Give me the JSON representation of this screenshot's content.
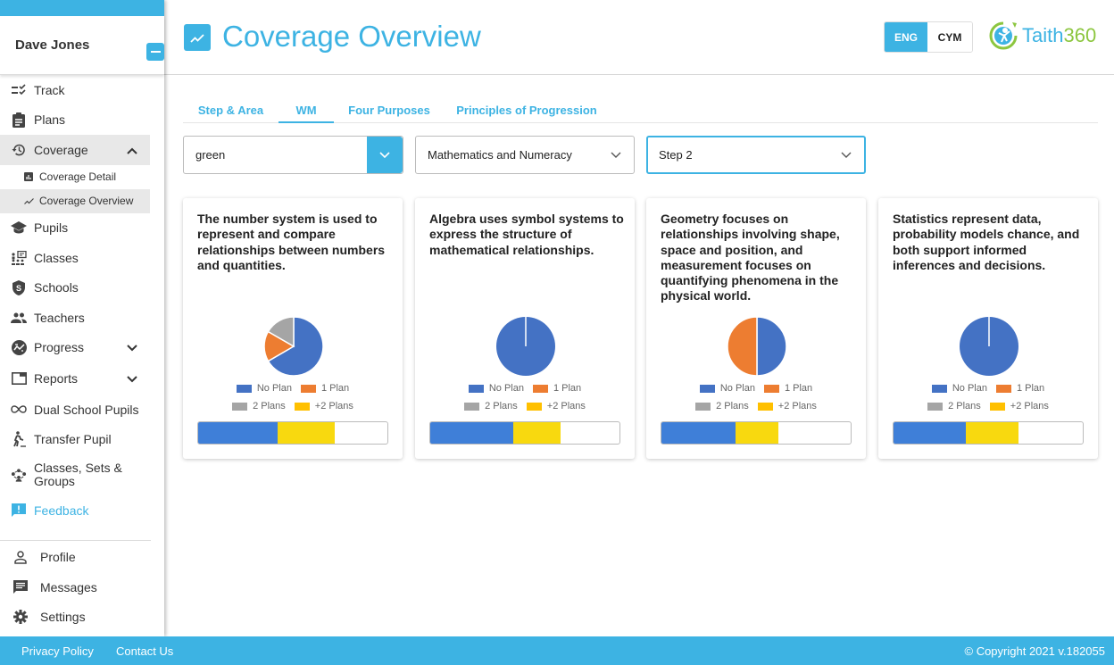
{
  "user": {
    "name": "Dave Jones"
  },
  "sidebar": {
    "items": [
      {
        "label": "Track",
        "icon": "track-icon"
      },
      {
        "label": "Plans",
        "icon": "clipboard-icon"
      },
      {
        "label": "Coverage",
        "icon": "history-icon",
        "expanded": true
      },
      {
        "label": "Coverage Detail",
        "icon": "bar-chart-icon"
      },
      {
        "label": "Coverage Overview",
        "icon": "trend-icon",
        "active": true
      },
      {
        "label": "Pupils",
        "icon": "graduation-cap-icon"
      },
      {
        "label": "Classes",
        "icon": "classroom-icon"
      },
      {
        "label": "Schools",
        "icon": "shield-icon"
      },
      {
        "label": "Teachers",
        "icon": "people-icon"
      },
      {
        "label": "Progress",
        "icon": "progress-icon"
      },
      {
        "label": "Reports",
        "icon": "window-icon"
      },
      {
        "label": "Dual School Pupils",
        "icon": "infinity-icon"
      },
      {
        "label": "Transfer Pupil",
        "icon": "walking-icon"
      },
      {
        "label": "Classes, Sets & Groups",
        "icon": "groups-icon"
      },
      {
        "label": "Feedback",
        "icon": "feedback-icon"
      }
    ],
    "bottom": [
      {
        "label": "Profile",
        "icon": "person-icon"
      },
      {
        "label": "Messages",
        "icon": "message-icon"
      },
      {
        "label": "Settings",
        "icon": "gear-icon"
      }
    ]
  },
  "header": {
    "title": "Coverage Overview",
    "lang_eng": "ENG",
    "lang_cym": "CYM",
    "logo_part1": "Taith",
    "logo_part2": "360"
  },
  "tabs": [
    {
      "label": "Step & Area",
      "active": false
    },
    {
      "label": "WM",
      "active": true
    },
    {
      "label": "Four Purposes",
      "active": false
    },
    {
      "label": "Principles of Progression",
      "active": false
    }
  ],
  "filters": {
    "group": "green",
    "area": "Mathematics and Numeracy",
    "step": "Step 2"
  },
  "legend": {
    "no_plan": "No Plan",
    "one_plan": "1 Plan",
    "two_plans": "2 Plans",
    "more_plans": "+2 Plans"
  },
  "colors": {
    "accent": "#3db3e3",
    "no_plan": "#4472c4",
    "one_plan": "#ed7d31",
    "two_plans": "#a5a5a5",
    "more_plans": "#ffc000",
    "bar_blue": "#3f7fd8",
    "bar_yellow": "#f8d90f"
  },
  "chart_data": [
    {
      "type": "pie",
      "title": "The number system is used to represent and compare relationships between numbers and quantities.",
      "categories": [
        "No Plan",
        "1 Plan",
        "2 Plans",
        "+2 Plans"
      ],
      "values": [
        66.7,
        16.7,
        16.7,
        0
      ],
      "progress": {
        "blue_pct": 42,
        "yellow_pct": 30
      }
    },
    {
      "type": "pie",
      "title": "Algebra uses symbol systems to express the structure of mathematical relationships.",
      "categories": [
        "No Plan",
        "1 Plan",
        "2 Plans",
        "+2 Plans"
      ],
      "values": [
        100,
        0,
        0,
        0
      ],
      "progress": {
        "blue_pct": 44,
        "yellow_pct": 25
      }
    },
    {
      "type": "pie",
      "title": "Geometry focuses on relationships involving shape, space and position, and measurement focuses on quantifying phenomena in the physical world.",
      "categories": [
        "No Plan",
        "1 Plan",
        "2 Plans",
        "+2 Plans"
      ],
      "values": [
        50,
        50,
        0,
        0
      ],
      "progress": {
        "blue_pct": 39,
        "yellow_pct": 23
      }
    },
    {
      "type": "pie",
      "title": "Statistics represent data, probability models chance, and both support informed inferences and decisions.",
      "categories": [
        "No Plan",
        "1 Plan",
        "2 Plans",
        "+2 Plans"
      ],
      "values": [
        100,
        0,
        0,
        0
      ],
      "progress": {
        "blue_pct": 38,
        "yellow_pct": 28
      }
    }
  ],
  "footer": {
    "privacy": "Privacy Policy",
    "contact": "Contact Us",
    "copyright": "© Copyright 2021 v.182055"
  }
}
